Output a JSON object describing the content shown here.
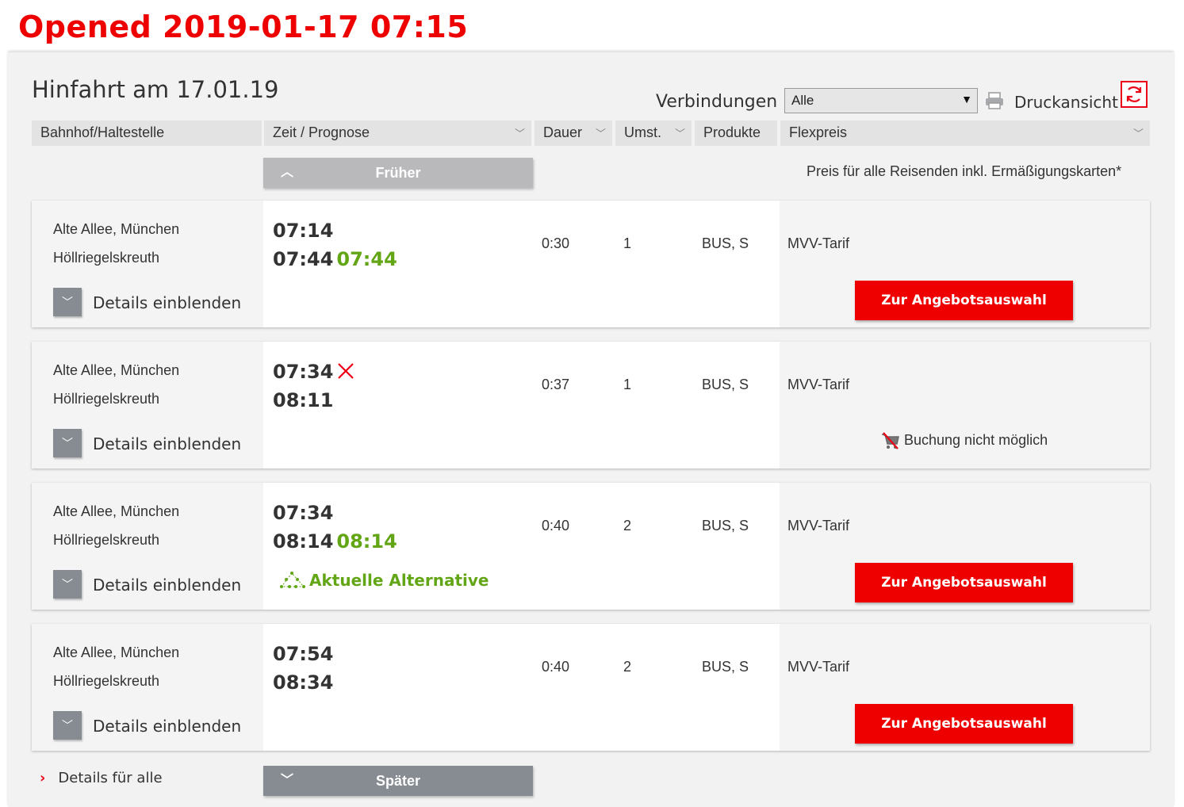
{
  "banner": {
    "text": "Opened 2019-01-17 07:15"
  },
  "header": {
    "title": "Hinfahrt am 17.01.19",
    "verbindungen_label": "Verbindungen",
    "verbindungen_value": "Alle",
    "print_label": "Druckansicht"
  },
  "columns": {
    "station": "Bahnhof/Haltestelle",
    "time": "Zeit / Prognose",
    "duration": "Dauer",
    "changes": "Umst.",
    "products": "Produkte",
    "price": "Flexpreis"
  },
  "earlier_label": "Früher",
  "later_label": "Später",
  "price_note": "Preis für alle Reisenden inkl. Ermäßigungskarten*",
  "details_all_label": "Details für alle",
  "connections": [
    {
      "from": "Alte Allee, München",
      "to": "Höllriegelskreuth",
      "dep": "07:14",
      "arr": "07:44",
      "arr_realtime": "07:44",
      "duration": "0:30",
      "changes": "1",
      "products": "BUS, S",
      "tariff": "MVV-Tarif",
      "details_label": "Details einblenden",
      "offer_label": "Zur Angebotsauswahl"
    },
    {
      "from": "Alte Allee, München",
      "to": "Höllriegelskreuth",
      "dep": "07:34",
      "arr": "08:11",
      "duration": "0:37",
      "changes": "1",
      "products": "BUS, S",
      "tariff": "MVV-Tarif",
      "details_label": "Details einblenden",
      "booking_status": "Buchung nicht möglich",
      "cancelled_icon": "cancel-x-icon"
    },
    {
      "from": "Alte Allee, München",
      "to": "Höllriegelskreuth",
      "dep": "07:34",
      "arr": "08:14",
      "arr_realtime": "08:14",
      "duration": "0:40",
      "changes": "2",
      "products": "BUS, S",
      "tariff": "MVV-Tarif",
      "details_label": "Details einblenden",
      "offer_label": "Zur Angebotsauswahl",
      "alternative_label": "Aktuelle Alternative"
    },
    {
      "from": "Alte Allee, München",
      "to": "Höllriegelskreuth",
      "dep": "07:54",
      "arr": "08:34",
      "duration": "0:40",
      "changes": "2",
      "products": "BUS, S",
      "tariff": "MVV-Tarif",
      "details_label": "Details einblenden",
      "offer_label": "Zur Angebotsauswahl"
    }
  ],
  "colors": {
    "accent_red": "#ee0000",
    "realtime_green": "#63a615",
    "gray_button": "#878b92"
  }
}
